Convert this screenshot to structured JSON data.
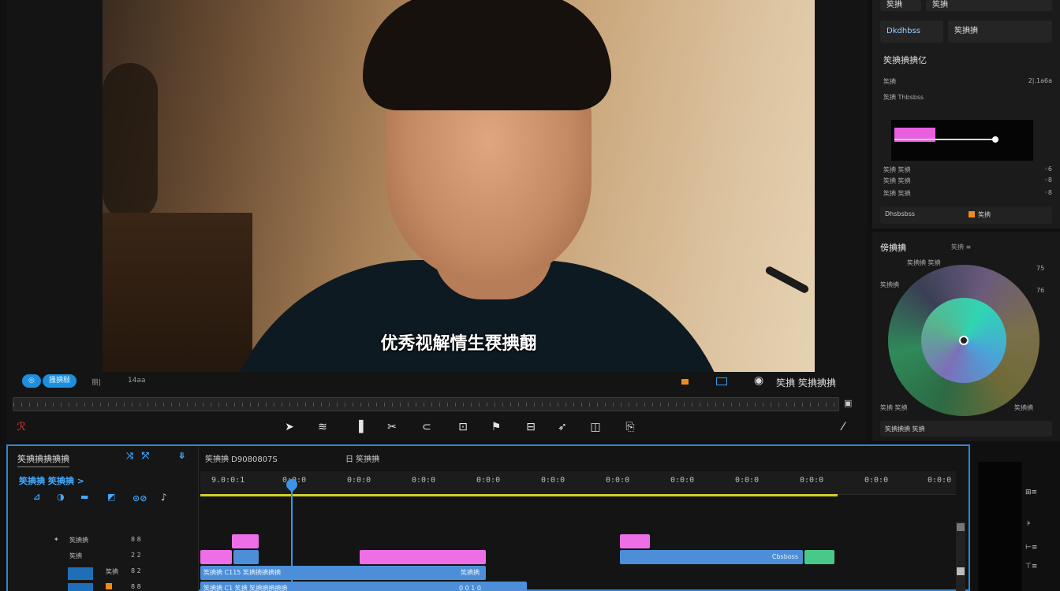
{
  "viewer": {
    "subtitle": "优秀视解情生覄捵翸",
    "toolbar_pill_a": "◎",
    "toolbar_pill_b": "搔捵敡",
    "toolbar_text_a": "丽|",
    "toolbar_text_b": "14aa",
    "right_label": "笶捵 笶捵捵捵",
    "transport_icons": [
      "pen-icon",
      "ripple-icon",
      "bookmark-icon",
      "blade-icon",
      "sign-icon",
      "crop-icon",
      "flag-icon",
      "transform-icon",
      "arrow-icon",
      "layers-icon",
      "export-icon"
    ]
  },
  "inspector": {
    "tab_a": "笶捵",
    "tab_b": "笶捵",
    "tab_c": "Dkdhbss",
    "tab_d": "笶捵捵",
    "section_title": "笶捵捵捵亿",
    "rows": [
      {
        "label": "笶捵",
        "value": "2|.1a6a"
      },
      {
        "label": "笶捵 Thbsbss",
        "value": ""
      },
      {
        "label": "笶捵 笶捵",
        "value": "◦6"
      },
      {
        "label": "笶捵 笶捵",
        "value": "◦8"
      },
      {
        "label": "笶捵 笶捵",
        "value": "◦8"
      }
    ],
    "footer_a": "Dhsbsbss",
    "footer_b": "笶捵"
  },
  "colorpanel": {
    "title": "傍捵捵",
    "sub": "笶捵 ≡",
    "top_label": "笶捵捵 笶捵",
    "side_left": "笶捵捵",
    "right_a": "75",
    "right_b": "76",
    "bottom_left": "笶捵 笶捵",
    "bottom_right": "笶捵捵",
    "footer": "笶捵捵捵 笶捵"
  },
  "timeline": {
    "panel_title": "笶捵捵捵捵捵",
    "panel_sub": "笶捵捵 笶捵捵 >",
    "sequence_label": "笶捵捵 D9080807S",
    "sequence_label_b": "日 笶捵捵",
    "timecodes": [
      "9.0:0:1",
      "0:0:0",
      "0:0:0",
      "0:0:0",
      "0:0:0",
      "0:0:0",
      "0:0:0",
      "0:0:0",
      "0:0:0",
      "0:0:0",
      "0:0:0",
      "0:0:0"
    ],
    "track_rows": [
      {
        "name": "笶捵捵",
        "v": "8 8"
      },
      {
        "name": "笶捵",
        "v": "2 2"
      },
      {
        "name": "笶捵",
        "v": "8 2"
      },
      {
        "name": "笶捵",
        "v": "8 8"
      }
    ],
    "clips": [
      {
        "label": "笶捵捵 C115 笶捵捵捵捵捵",
        "tail": "笶捵捵"
      },
      {
        "label": "笶捵捵 C1 笶捵 笶捵捵捵捵捵",
        "tail": "0 0 1 0"
      },
      {
        "label": "Cbsboss",
        "tail": ""
      }
    ]
  },
  "colors": {
    "accent": "#2d86d8",
    "pink": "#ee6ee8",
    "blue": "#4c8fd8",
    "green": "#49c989",
    "yellow": "#cfd12a"
  }
}
